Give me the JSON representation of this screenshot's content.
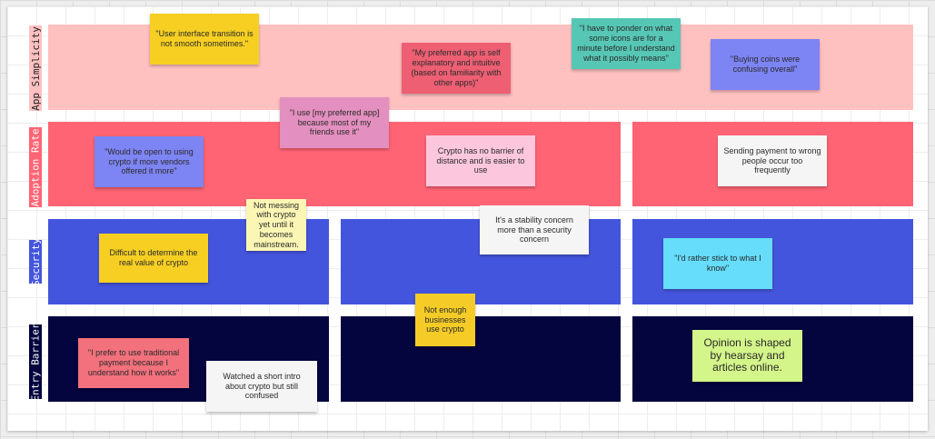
{
  "colors": {
    "canvas": "#eeeeee",
    "board": "#ffffff",
    "app_simplicity": "#ffc0c0",
    "adoption_rate": "#ff6474",
    "security": "#4455dd",
    "entry_barrier": "#04043f",
    "yellow_note": "#f6cf22",
    "pink_note": "#ee5f73",
    "teal_note": "#56c7b5",
    "blue_note": "#7d84f3",
    "mauve_note": "#e38fbf",
    "light_pink_note": "#fcc7dd",
    "white_note": "#f5f5f5",
    "pale_yellow_note": "#fcf6b4",
    "gold_note": "#f5cc27",
    "sky_note": "#65ddfb",
    "salmon_note": "#f2717c",
    "lime_note": "#d4f58a"
  },
  "lanes": [
    {
      "label": "App Simplicity"
    },
    {
      "label": "Adoption Rate"
    },
    {
      "label": "Security"
    },
    {
      "label": "Entry Barrier"
    }
  ],
  "notes": [
    {
      "text": "\"User interface transition is not smooth sometimes.\""
    },
    {
      "text": "\"My preferred app is self explanatory and intuitive (based on familiarity with other apps)\""
    },
    {
      "text": "\"I have to ponder on what some icons are for a minute before I understand what it possibly means\""
    },
    {
      "text": "\"Buying coins were confusing overall\""
    },
    {
      "text": "\"I use [my preferred app] because most of my friends use it\""
    },
    {
      "text": "\"Would be open to using crypto if more vendors offered it more\""
    },
    {
      "text": "Crypto has no barrier of distance and is easier to use"
    },
    {
      "text": "Sending payment to wrong people occur too frequently"
    },
    {
      "text": "Not messing with crypto yet until it becomes mainstream."
    },
    {
      "text": "It's a stability concern more than a security concern"
    },
    {
      "text": "Difficult to determine the real value of crypto"
    },
    {
      "text": "\"I'd rather stick to what I know\""
    },
    {
      "text": "Not enough businesses use crypto"
    },
    {
      "text": "\"I prefer to use traditional payment because I understand how it works\""
    },
    {
      "text": "Watched a short intro about crypto but still confused"
    },
    {
      "text": "Opinion is shaped by hearsay and articles online."
    }
  ]
}
